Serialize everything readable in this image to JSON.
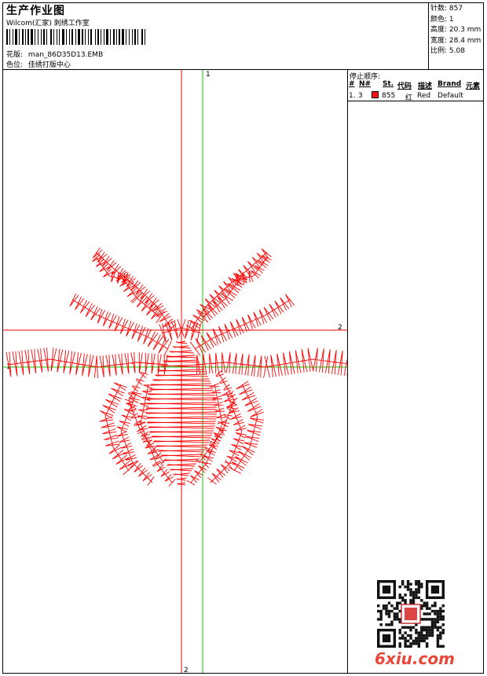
{
  "header": {
    "title": "生产作业图",
    "studio": "Wilcom(汇家) 刺绣工作室",
    "design_label": "花版:",
    "design_file": "man_86D35D13.EMB",
    "color_label": "色位:",
    "color_value": "佳绣打版中心"
  },
  "stats": {
    "stitches": "针数: 857",
    "colors": "颜色: 1",
    "height": "高度: 20.3 mm",
    "width": "宽度: 28.4 mm",
    "scale": "比例: 5.08"
  },
  "stop_sequence": {
    "title": "停止顺序:",
    "headers": [
      "#",
      "N#",
      "St.",
      "代码",
      "描述",
      "Brand",
      "元素"
    ],
    "rows": [
      {
        "index": "1.",
        "needle": "3",
        "stitches": "855",
        "code": "红",
        "description": "Red",
        "brand": "Default",
        "swatch_color": "#ff1010"
      }
    ]
  },
  "canvas": {
    "green_axis_label_top": "1",
    "green_axis_label_left": "1",
    "red_axis_label_right": "2",
    "red_axis_label_bottom": "2",
    "stitch_color": "#ff0000",
    "axis_green": "#00cc00",
    "axis_red": "#ff0000"
  },
  "watermark": {
    "text": "6xiu.com"
  }
}
